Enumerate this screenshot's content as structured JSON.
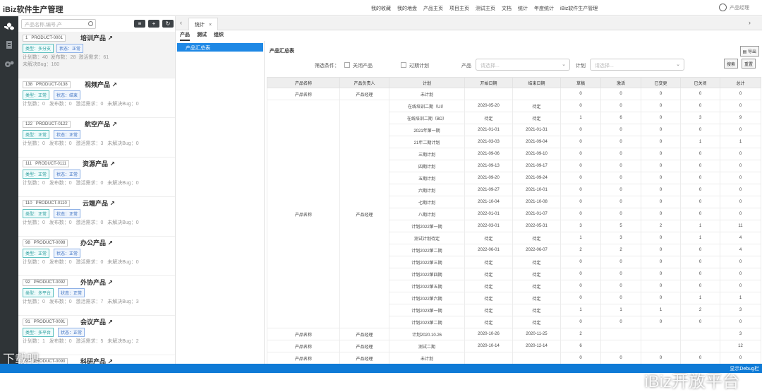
{
  "app": {
    "title": "iBiz软件生产管理",
    "user": "产品经理",
    "debug": "显示Debug栏"
  },
  "topnav": [
    "我的收藏",
    "我的地盘",
    "产品主页",
    "项目主页",
    "测试主页",
    "文档",
    "统计",
    "年度统计",
    "iBiz软件生产管理"
  ],
  "sidebar": {
    "search_placeholder": "产品名称,编号,产",
    "items": [
      {
        "num": "1",
        "code": "PRODUCT-0001",
        "name": "培训产品",
        "type": "类型：多分支",
        "status": "状态：正常",
        "stats": [
          "计划数：40",
          "发布数：28",
          "激活需求：61"
        ],
        "bug": "未解决Bug：160"
      },
      {
        "num": "138",
        "code": "PRODUCT-0138",
        "name": "视频产品",
        "type": "类型：正常",
        "status": "状态：结束",
        "stats": [
          "计划数：0",
          "发布数：0",
          "激活需求：0"
        ],
        "bug": "未解决Bug：0"
      },
      {
        "num": "122",
        "code": "PRODUCT-0122",
        "name": "航空产品",
        "type": "类型：正常",
        "status": "状态：正常",
        "stats": [
          "计划数：0",
          "发布数：0",
          "激活需求：3"
        ],
        "bug": "未解决Bug：0"
      },
      {
        "num": "111",
        "code": "PRODUCT-0111",
        "name": "资源产品",
        "type": "类型：正常",
        "status": "状态：正常",
        "stats": [
          "计划数：0",
          "发布数：0",
          "激活需求：0"
        ],
        "bug": "未解决Bug：0"
      },
      {
        "num": "110",
        "code": "PRODUCT-0110",
        "name": "云端产品",
        "type": "类型：正常",
        "status": "状态：正常",
        "stats": [
          "计划数：0",
          "发布数：0",
          "激活需求：0"
        ],
        "bug": "未解决Bug：0"
      },
      {
        "num": "98",
        "code": "PRODUCT-0098",
        "name": "办公产品",
        "type": "类型：正常",
        "status": "状态：正常",
        "stats": [
          "计划数：0",
          "发布数：0",
          "激活需求：0"
        ],
        "bug": "未解决Bug：0"
      },
      {
        "num": "92",
        "code": "PRODUCT-0092",
        "name": "外协产品",
        "type": "类型：多平台",
        "status": "状态：正常",
        "stats": [
          "计划数：0",
          "发布数：0",
          "激活需求：7"
        ],
        "bug": "未解决Bug：3"
      },
      {
        "num": "91",
        "code": "PRODUCT-0091",
        "name": "会议产品",
        "type": "类型：多平台",
        "status": "状态：正常",
        "stats": [
          "计划数：1",
          "发布数：0",
          "激活需求：5"
        ],
        "bug": "未解决Bug：2"
      },
      {
        "num": "90",
        "code": "PRODUCT-0090",
        "name": "科研产品",
        "type": "",
        "status": "",
        "stats": [
          "",
          "",
          ""
        ],
        "bug": ""
      }
    ]
  },
  "tabs": {
    "active": "统计"
  },
  "subtabs": [
    "产品",
    "测试",
    "组织"
  ],
  "tree": {
    "selected": "产品汇总表"
  },
  "report": {
    "title": "产品汇总表",
    "export_label": "导出",
    "filter_label": "筛选条件：",
    "close_product": "关闭产品",
    "expired_plan": "过期计划",
    "product_label": "产品",
    "plan_label": "计划",
    "select_placeholder": "请选择...",
    "search_btn": "搜索",
    "reset_btn": "重置",
    "columns": [
      "产品名称",
      "产品负责人",
      "计划",
      "开始日期",
      "结束日期",
      "草稿",
      "激活",
      "已变更",
      "已关闭",
      "总计"
    ],
    "rows": [
      [
        "产品名称",
        "产品经理",
        "未计划",
        "",
        "",
        "0",
        "0",
        "0",
        "0",
        "0"
      ],
      [
        "",
        "",
        "在线培训二期（UI）",
        "2020-05-20",
        "待定",
        "0",
        "0",
        "0",
        "0",
        "0"
      ],
      [
        "",
        "",
        "在线培训二期（BD）",
        "待定",
        "待定",
        "1",
        "6",
        "0",
        "3",
        "9"
      ],
      [
        "",
        "",
        "2021年第一期",
        "2021-01-01",
        "2021-01-31",
        "0",
        "0",
        "0",
        "0",
        "0"
      ],
      [
        "",
        "",
        "21年二期计划",
        "2021-03-03",
        "2021-09-04",
        "0",
        "0",
        "0",
        "1",
        "1"
      ],
      [
        "",
        "",
        "三期计划",
        "2021-09-06",
        "2021-09-10",
        "0",
        "0",
        "0",
        "0",
        "0"
      ],
      [
        "",
        "",
        "四期计划",
        "2021-09-13",
        "2021-09-17",
        "0",
        "0",
        "0",
        "0",
        "0"
      ],
      [
        "",
        "",
        "五期计划",
        "2021-09-20",
        "2021-09-24",
        "0",
        "0",
        "0",
        "0",
        "0"
      ],
      [
        "",
        "",
        "六期计划",
        "2021-09-27",
        "2021-10-01",
        "0",
        "0",
        "0",
        "0",
        "0"
      ],
      [
        "",
        "",
        "七期计划",
        "2021-10-04",
        "2021-10-08",
        "0",
        "0",
        "0",
        "0",
        "0"
      ],
      [
        "产品名称",
        "产品经理",
        "八期计划",
        "2022-01-01",
        "2021-01-07",
        "0",
        "0",
        "0",
        "0",
        "0"
      ],
      [
        "",
        "",
        "计划2022第一期",
        "2022-03-01",
        "2022-05-31",
        "3",
        "5",
        "2",
        "1",
        "11"
      ],
      [
        "",
        "",
        "测试计划待定",
        "待定",
        "待定",
        "1",
        "3",
        "0",
        "1",
        "4"
      ],
      [
        "",
        "",
        "计划2022第二期",
        "2022-06-01",
        "2022-06-07",
        "2",
        "2",
        "0",
        "0",
        "4"
      ],
      [
        "",
        "",
        "计划2022第三期",
        "待定",
        "待定",
        "0",
        "0",
        "0",
        "0",
        "0"
      ],
      [
        "",
        "",
        "计划2022第四期",
        "待定",
        "待定",
        "0",
        "0",
        "0",
        "0",
        "0"
      ],
      [
        "",
        "",
        "计划2022第五期",
        "待定",
        "待定",
        "0",
        "0",
        "0",
        "0",
        "0"
      ],
      [
        "",
        "",
        "计划2022第六期",
        "待定",
        "待定",
        "0",
        "0",
        "0",
        "1",
        "1"
      ],
      [
        "",
        "",
        "计划2023第一期",
        "待定",
        "待定",
        "1",
        "1",
        "1",
        "2",
        "3"
      ],
      [
        "",
        "",
        "计划2023第二期",
        "待定",
        "待定",
        "0",
        "0",
        "0",
        "0",
        "0"
      ],
      [
        "产品名称",
        "产品经理",
        "计划2020.10.26",
        "2020-10-26",
        "2020-11-25",
        "2",
        "",
        "",
        "",
        "3"
      ],
      [
        "产品名称",
        "产品经理",
        "测试二期",
        "2020-10-14",
        "2020-12-14",
        "6",
        "",
        "",
        "",
        "12"
      ],
      [
        "产品名称",
        "产品经理",
        "未计划",
        "",
        "",
        "0",
        "0",
        "0",
        "0",
        "0"
      ]
    ]
  },
  "watermarks": {
    "right": "iBiz开放平台",
    "left": "下载吧"
  }
}
